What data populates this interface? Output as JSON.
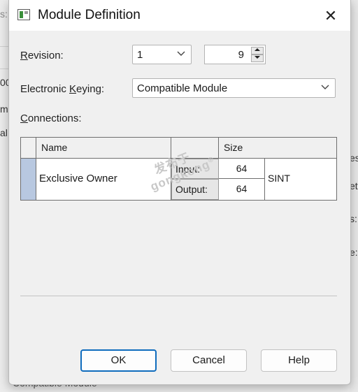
{
  "dialog": {
    "title": "Module Definition",
    "close_symbol": "✕"
  },
  "revision": {
    "label_accel": "R",
    "label_rest": "evision:",
    "major": "1",
    "minor": "9"
  },
  "keying": {
    "label_pre": "Electronic ",
    "label_accel": "K",
    "label_post": "eying:",
    "value": "Compatible Module"
  },
  "connections": {
    "label_accel": "C",
    "label_rest": "onnections:",
    "columns": [
      "Name",
      "",
      "Size"
    ],
    "rows": [
      {
        "name": "Exclusive Owner",
        "input_label": "Input:",
        "input_size": "64",
        "output_label": "Output:",
        "output_size": "64",
        "type": "SINT"
      }
    ]
  },
  "watermark": {
    "line1": "发布于",
    "line2": "gongkong",
    "mark": "®"
  },
  "buttons": {
    "ok": "OK",
    "cancel": "Cancel",
    "help": "Help"
  },
  "background": {
    "frag1": "s:",
    "frag2": "00",
    "frag3": "m",
    "frag4": "alB",
    "frag5": "es",
    "frag6": "etv",
    "frag7": "s:",
    "frag8": "e:",
    "frag9": "Compatible Module"
  }
}
